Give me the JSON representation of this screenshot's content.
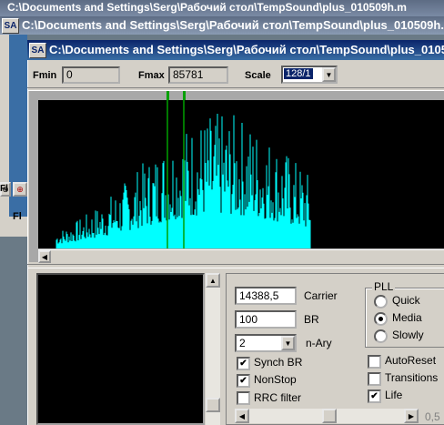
{
  "back_window": {
    "title": "C:\\Documents and Settings\\Serg\\Рабочий стол\\TempSound\\plus_010509h.m"
  },
  "main_window": {
    "title": "C:\\Documents and Settings\\Serg\\Рабочий стол\\TempSound\\plus_0105",
    "icon_text": "SA"
  },
  "toolbar": {
    "fmin_label": "Fmin",
    "fmin_value": "0",
    "fmax_label": "Fmax",
    "fmax_value": "85781",
    "scale_label": "Scale",
    "scale_value": "128/1"
  },
  "left_strip": {
    "f1": "Fl",
    "f2": "Fl"
  },
  "controls": {
    "carrier_value": "14388,5",
    "carrier_label": "Carrier",
    "br_value": "100",
    "br_label": "BR",
    "nary_value": "2",
    "nary_label": "n-Ary",
    "synch_br": "Synch BR",
    "nonstop": "NonStop",
    "rrc_filter": "RRC filter",
    "autoreset": "AutoReset",
    "transitions": "Transitions",
    "life": "Life",
    "bottom_value": "0,5"
  },
  "pll": {
    "title": "PLL",
    "quick": "Quick",
    "media": "Media",
    "slowly": "Slowly",
    "selected": "Media"
  },
  "spectrum": {
    "background": "#000000",
    "bar_color": "#00ffff",
    "center_fraction": 0.45,
    "peak_level": 0.92,
    "spread": 0.2
  },
  "colors": {
    "title_active": "#0a246a",
    "face": "#d4d0c8",
    "marker": "#00a000"
  }
}
